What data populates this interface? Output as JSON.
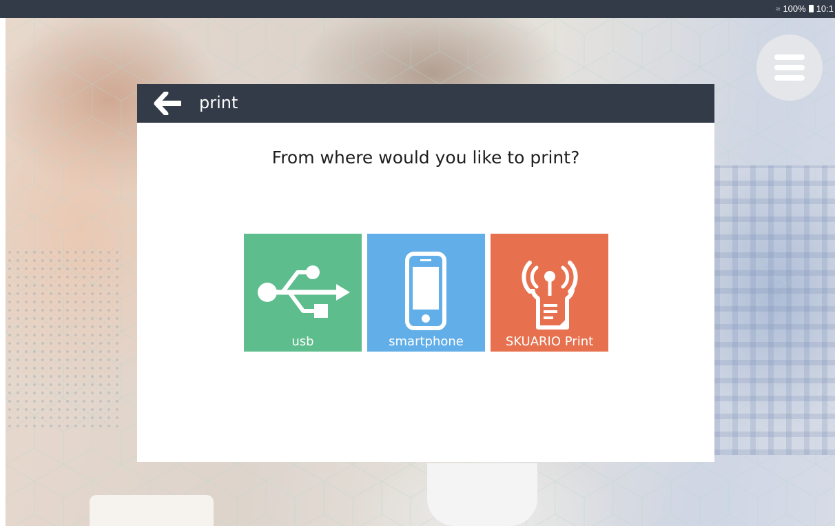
{
  "status_bar": {
    "battery_percent": "100%",
    "time": "10:1"
  },
  "dialog": {
    "title": "print",
    "question": "From where would you like to print?"
  },
  "options": [
    {
      "label": "usb",
      "color": "#5dbd8d",
      "icon": "usb-icon"
    },
    {
      "label": "smartphone",
      "color": "#62aee8",
      "icon": "smartphone-icon"
    },
    {
      "label": "SKUARIO Print",
      "color": "#e7714e",
      "icon": "skuario-print-icon"
    }
  ],
  "colors": {
    "header": "#323b47",
    "statusbar": "#323b47"
  }
}
